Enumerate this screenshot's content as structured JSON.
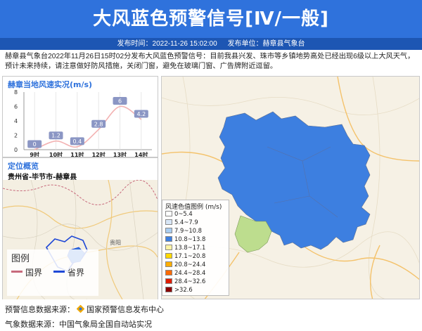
{
  "header": {
    "title": "大风蓝色预警信号[Ⅳ/一般]",
    "publish_time_label": "发布时间：",
    "publish_time": "2022-11-26 15:02:00",
    "publish_unit_label": "发布单位：",
    "publish_unit": "赫章县气象台"
  },
  "description": "赫章县气象台2022年11月26日15时02分发布大风蓝色预警信号：目前我县兴发、珠市等乡镇地势高处已经出现6级以上大风天气，预计未来持续，请注意做好防风措施，关闭门窗，避免在玻璃门窗、广告牌附近逗留。",
  "wind_panel": {
    "title": "赫章当地风速实况(m/s)"
  },
  "chart_data": {
    "type": "line",
    "title": "赫章当地风速实况(m/s)",
    "categories": [
      "9时",
      "10时",
      "11时",
      "12时",
      "13时",
      "14时"
    ],
    "values": [
      0,
      1.2,
      0.4,
      2.8,
      6,
      4.2
    ],
    "data_labels": [
      "0",
      "1.2",
      "0.4",
      "2.8",
      "6",
      "4.2"
    ],
    "y_ticks": [
      "0",
      "2",
      "4",
      "6",
      "8"
    ],
    "ylim": [
      0,
      8
    ],
    "grid": "vertical",
    "line_color": "#f3b2b2",
    "label_color": "#8b96c4"
  },
  "location_panel": {
    "title": "定位概览",
    "subtitle": "贵州省-毕节市-赫章县",
    "map_label": "贵阳",
    "legend_title": "图例",
    "legend_items": [
      {
        "label": "国界",
        "color": "#c76a7c"
      },
      {
        "label": "省界",
        "color": "#1f48d6"
      }
    ]
  },
  "wind_legend": {
    "title": "风速色值图例 (m/s)",
    "items": [
      {
        "label": "0~5.4",
        "color": "#ffffff"
      },
      {
        "label": "5.4~7.9",
        "color": "#d8e6f6"
      },
      {
        "label": "7.9~10.8",
        "color": "#a9cdf0"
      },
      {
        "label": "10.8~13.8",
        "color": "#3d7fe0"
      },
      {
        "label": "13.8~17.1",
        "color": "#fff3a6"
      },
      {
        "label": "17.1~20.8",
        "color": "#ffd900"
      },
      {
        "label": "20.8~24.4",
        "color": "#ffae00"
      },
      {
        "label": "24.4~28.4",
        "color": "#ff6a00"
      },
      {
        "label": "28.4~32.6",
        "color": "#e01c00"
      },
      {
        "label": ">32.6",
        "color": "#8b0000"
      }
    ]
  },
  "footer": {
    "source1_label": "预警信息数据来源：",
    "source1": "国家预警信息发布中心",
    "source2_label": "气象数据来源：",
    "source2": "中国气象局全国自动站实况"
  },
  "colors": {
    "header_bg": "#2f72dc",
    "subbar_bg": "#1d56b3",
    "county_fill": "#3d7fe0",
    "county_small_fill": "#bddd8e",
    "location_county_fill": "#2f72dc"
  }
}
